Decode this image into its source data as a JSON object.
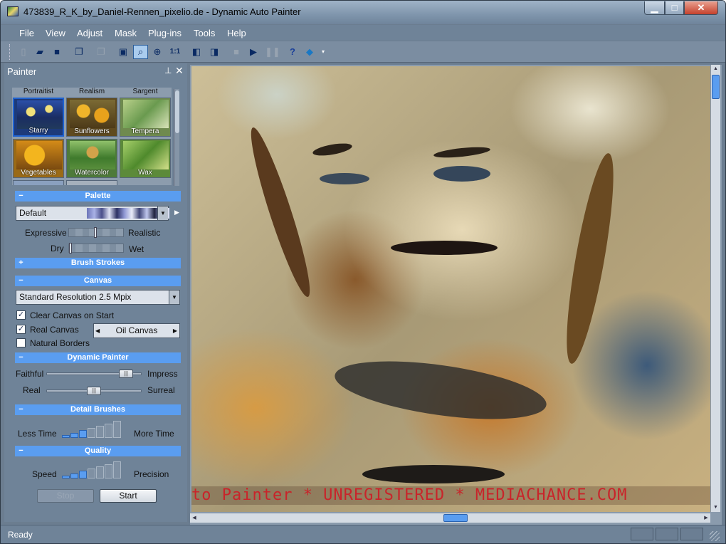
{
  "window": {
    "title": "473839_R_K_by_Daniel-Rennen_pixelio.de - Dynamic Auto Painter"
  },
  "menu": [
    "File",
    "View",
    "Adjust",
    "Mask",
    "Plug-ins",
    "Tools",
    "Help"
  ],
  "toolbar": {
    "zoom_1to1": "1:1"
  },
  "panel": {
    "title": "Painter"
  },
  "gallery": {
    "columns": [
      "Portraitist",
      "Realism",
      "Sargent"
    ],
    "styles": [
      {
        "label": "Starry",
        "selected": true
      },
      {
        "label": "Sunflowers",
        "selected": false
      },
      {
        "label": "Tempera",
        "selected": false
      },
      {
        "label": "Vegetables",
        "selected": false
      },
      {
        "label": "Watercolor",
        "selected": false
      },
      {
        "label": "Wax",
        "selected": false
      }
    ]
  },
  "palette": {
    "header": "Palette",
    "selected": "Default",
    "expressive_label": "Expressive",
    "realistic_label": "Realistic",
    "expressive_level": 0.5,
    "dry_label": "Dry",
    "wet_label": "Wet",
    "dry_level": 0.0
  },
  "brush_strokes": {
    "header": "Brush Strokes"
  },
  "canvas": {
    "header": "Canvas",
    "resolution": "Standard Resolution 2.5 Mpix",
    "clear_on_start": {
      "label": "Clear Canvas on Start",
      "checked": true
    },
    "real_canvas": {
      "label": "Real Canvas",
      "checked": true,
      "type": "Oil Canvas"
    },
    "natural_borders": {
      "label": "Natural Borders",
      "checked": false
    }
  },
  "dynamic_painter": {
    "header": "Dynamic Painter",
    "faithful_label": "Faithful",
    "impress_label": "Impress",
    "faithful_level": 0.9,
    "real_label": "Real",
    "surreal_label": "Surreal",
    "real_level": 0.5
  },
  "detail_brushes": {
    "header": "Detail Brushes",
    "less_label": "Less Time",
    "more_label": "More Time",
    "level_steps": 3,
    "total_steps": 7
  },
  "quality": {
    "header": "Quality",
    "speed_label": "Speed",
    "precision_label": "Precision",
    "level_steps": 3,
    "total_steps": 7
  },
  "actions": {
    "stop_label": "Stop",
    "start_label": "Start"
  },
  "canvas_view": {
    "watermark": "to Painter * UNREGISTERED * MEDIACHANCE.COM"
  },
  "status": {
    "text": "Ready"
  }
}
